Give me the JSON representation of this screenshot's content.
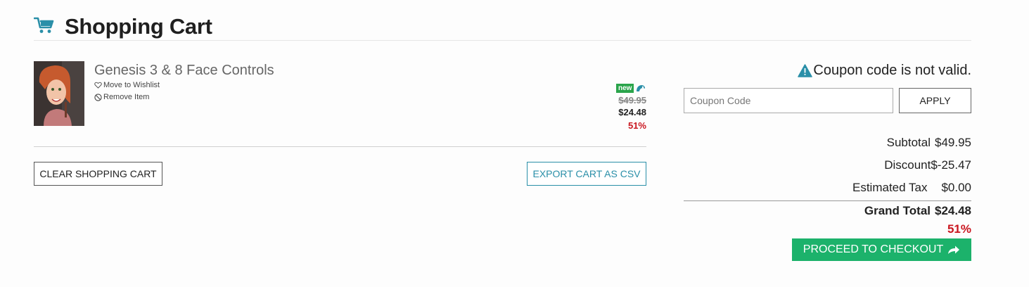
{
  "header": {
    "title": "Shopping Cart",
    "icon": "cart-icon"
  },
  "cart": {
    "items": [
      {
        "title": "Genesis 3 & 8 Face Controls",
        "thumbnail": "product-thumbnail",
        "actions": {
          "wishlist": "Move to Wishlist",
          "remove": "Remove Item"
        },
        "badge": "new",
        "original_price": "$49.95",
        "price": "$24.48",
        "discount_percent": "51%"
      }
    ],
    "clear_button": "CLEAR SHOPPING CART",
    "export_button": "EXPORT CART AS CSV"
  },
  "coupon": {
    "message": "Coupon code is not valid.",
    "placeholder": "Coupon Code",
    "value": "",
    "apply_button": "APPLY"
  },
  "summary": {
    "subtotal_label": "Subtotal",
    "subtotal_value": "$49.95",
    "discount_label": "Discount",
    "discount_value": "$-25.47",
    "tax_label": "Estimated Tax",
    "tax_value": "$0.00",
    "grand_total_label": "Grand Total",
    "grand_total_value": "$24.48",
    "grand_total_percent": "51%",
    "checkout_button": "PROCEED TO CHECKOUT"
  },
  "colors": {
    "accent": "#2a8fa8",
    "checkout": "#1cb26b",
    "discount_red": "#c9151e",
    "badge_green": "#2aa44b"
  }
}
